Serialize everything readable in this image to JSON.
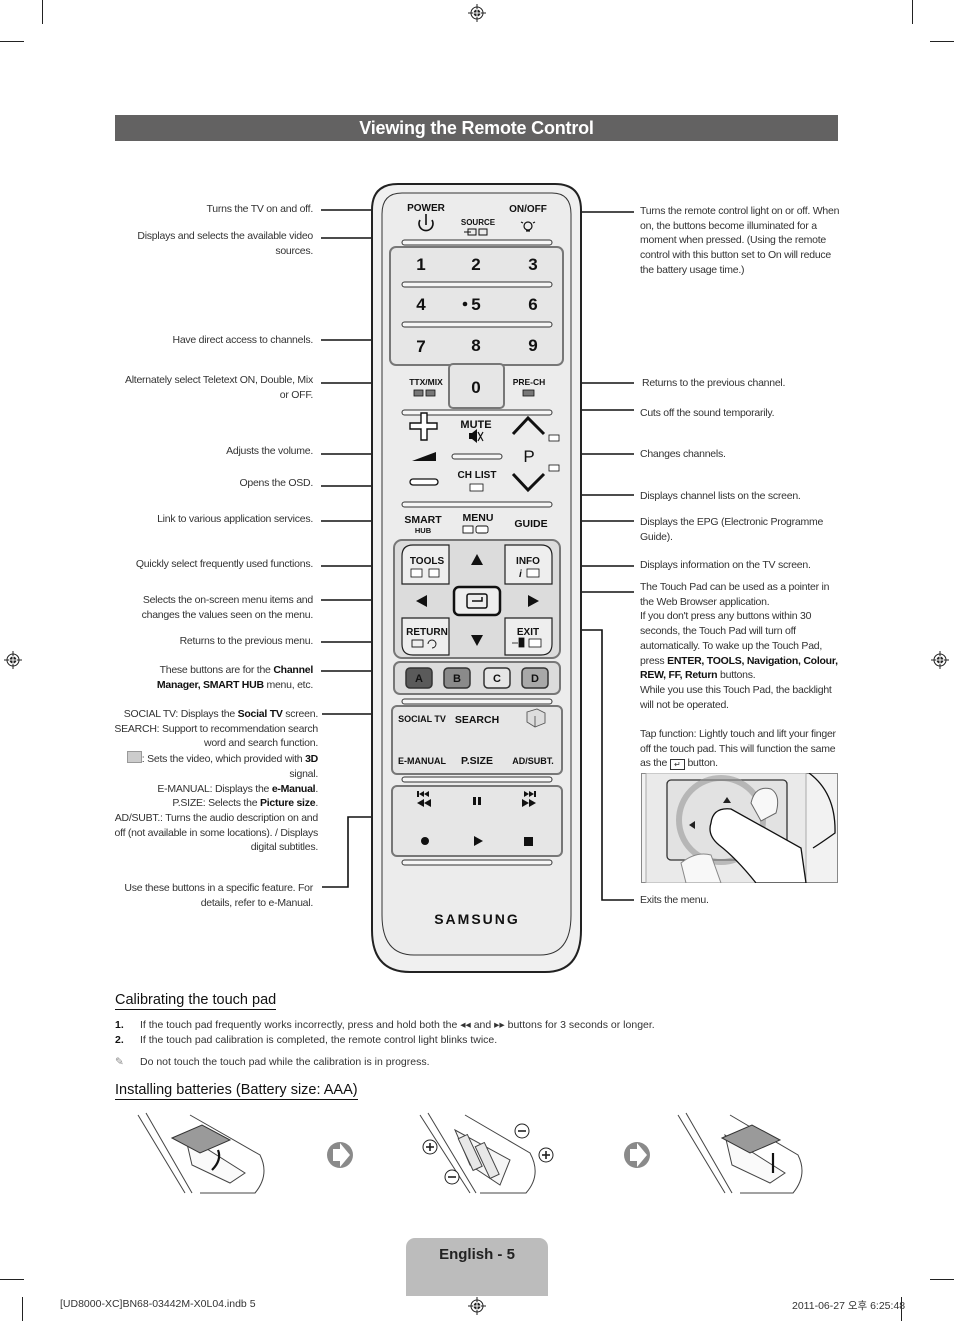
{
  "page": {
    "title": "Viewing the Remote Control",
    "page_label": "English - 5",
    "footer_left": "[UD8000-XC]BN68-03442M-X0L04.indb   5",
    "footer_right": "2011-06-27   오후 6:25:48"
  },
  "remote": {
    "brand": "SAMSUNG",
    "power": "POWER",
    "onoff": "ON/OFF",
    "source": "SOURCE",
    "digits": [
      "1",
      "2",
      "3",
      "4",
      "5",
      "6",
      "7",
      "8",
      "9",
      "0"
    ],
    "ttx": "TTX/MIX",
    "prech": "PRE-CH",
    "mute": "MUTE",
    "p": "P",
    "chlist": "CH LIST",
    "smart": "SMART",
    "hub": "HUB",
    "menu": "MENU",
    "guide": "GUIDE",
    "tools": "TOOLS",
    "info": "INFO",
    "return": "RETURN",
    "exit": "EXIT",
    "colors": [
      {
        "label": "A",
        "color": "#5a5a5a"
      },
      {
        "label": "B",
        "color": "#8a8a8a"
      },
      {
        "label": "C",
        "color": "#e6e6e6"
      },
      {
        "label": "D",
        "color": "#a8a8a8"
      }
    ],
    "social": "SOCIAL TV",
    "search": "SEARCH",
    "emanual": "E-MANUAL",
    "psize": "P.SIZE",
    "adsubt": "AD/SUBT."
  },
  "left_callouts": {
    "power": "Turns the TV on and off.",
    "source": "Displays and selects the available video sources.",
    "channels": "Have direct access to channels.",
    "ttx": "Alternately select Teletext ON, Double, Mix or OFF.",
    "volume": "Adjusts the volume.",
    "menu": "Opens the OSD.",
    "smarthub": "Link to various application services.",
    "tools": "Quickly select frequently used functions.",
    "nav": "Selects the on-screen menu items and changes the values seen on the menu.",
    "return": "Returns to the previous menu.",
    "colors_pre": "These buttons are for the ",
    "colors_b1": "Channel Manager, SMART HUB",
    "colors_post": " menu, etc.",
    "social_k": "SOCIAL TV",
    "social_t": ": Displays the ",
    "social_b": "Social TV",
    "social_e": " screen.",
    "search_k": "SEARCH",
    "search_t": ": Support to recommendation search word and search function.",
    "threed_t": ": Sets the video, which provided with ",
    "threed_b": "3D",
    "threed_e": " signal.",
    "emanual_k": "E-MANUAL",
    "emanual_t": ": Displays the ",
    "emanual_b": "e-Manual",
    "psize_k": "P.SIZE",
    "psize_t": ": Selects the ",
    "psize_b": "Picture size",
    "adsubt_k": "AD/SUBT.",
    "adsubt_t": ": Turns the audio description on and off (not available in some locations). / Displays digital subtitles.",
    "media": "Use these buttons in a specific feature. For details, refer to e-Manual."
  },
  "right_callouts": {
    "onoff": "Turns the remote control light on or off. When on, the buttons become illuminated for a moment when pressed. (Using the remote control with this button set to On will reduce the battery usage time.)",
    "prech": "Returns to the previous channel.",
    "mute": "Cuts off the sound temporarily.",
    "channel": "Changes channels.",
    "chlist": "Displays channel lists on the screen.",
    "guide": "Displays the EPG (Electronic Programme Guide).",
    "info": "Displays information on the TV screen.",
    "touch_1": "The Touch Pad can be used as a pointer in the Web Browser application.",
    "touch_2": "If you don't press any buttons within 30 seconds, the Touch Pad will turn off automatically. To wake up the Touch Pad, press ",
    "touch_b": "ENTER, TOOLS, Navigation, Colour, REW, FF, Return",
    "touch_3": " buttons.",
    "touch_4": "While you use this Touch Pad, the backlight will not be operated.",
    "tap_1": "Tap function: Lightly touch and lift your finger off the touch pad. This will function the same as the ",
    "tap_2": " button.",
    "exit": "Exits the menu."
  },
  "calibration": {
    "heading": "Calibrating the touch pad",
    "steps": [
      {
        "num": "1.",
        "pre": "If the touch pad frequently works incorrectly, press and hold both the ",
        "mid": " and ",
        "post": " buttons for 3 seconds or longer."
      },
      {
        "num": "2.",
        "text": "If the touch pad calibration is completed, the remote control light blinks twice."
      }
    ],
    "note": "Do not touch the touch pad while the calibration is in progress."
  },
  "batteries": {
    "heading": "Installing batteries (Battery size: AAA)"
  }
}
